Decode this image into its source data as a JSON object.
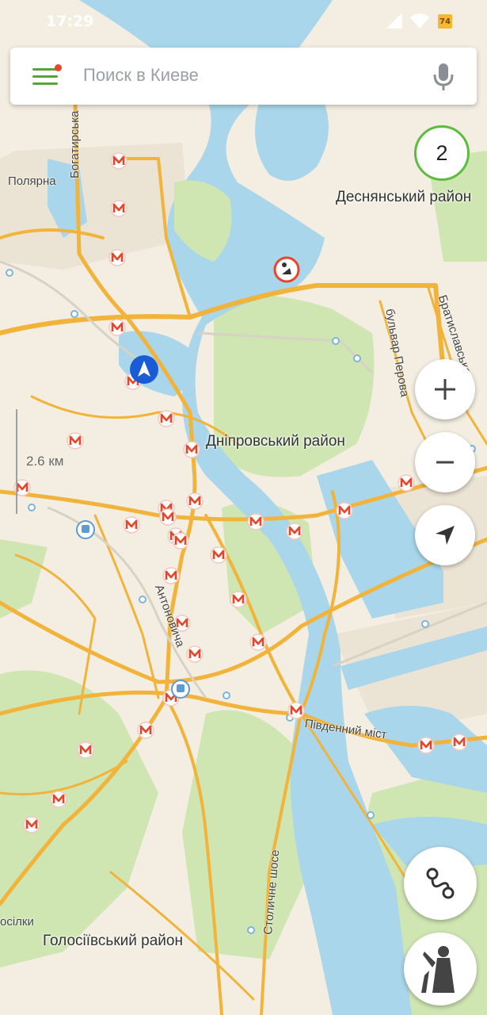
{
  "status": {
    "time": "17:29",
    "battery": "74"
  },
  "search": {
    "placeholder": "Поиск в Киеве"
  },
  "map": {
    "results_count": "2",
    "scale": "2.6 км",
    "districts": {
      "desnianskyi": "Деснянський район",
      "dniprovskyi": "Дніпровський район",
      "holosiivskyi": "Голосіївський район"
    },
    "streets": {
      "bohatyrska": "Богатирська",
      "poliarna": "Полярна",
      "bulvar_perova": "бульвар Перова",
      "bratyslavska": "Братиславська",
      "antonovycha": "Антоновича",
      "pivdennyi_mist": "Південний міст",
      "stolychne_shose": "Столичне шосе",
      "vasylkivska_partial": "осілки"
    }
  },
  "colors": {
    "accent": "#57a53a",
    "metro": "#e8462a",
    "water": "#a8d8ea",
    "park": "#c8e3a8",
    "road": "#f4b43c"
  }
}
